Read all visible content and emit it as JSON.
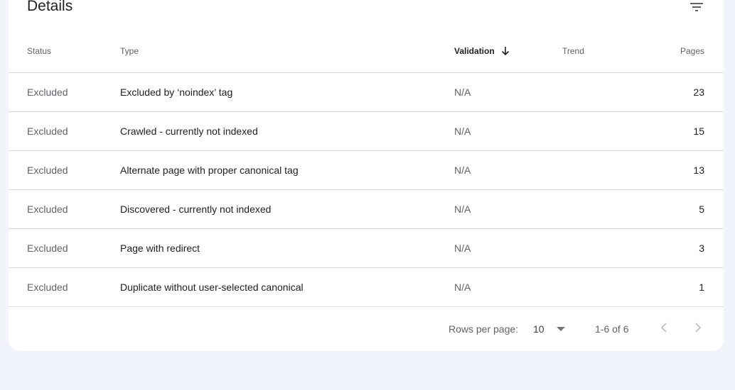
{
  "title": "Details",
  "icons": {
    "filter": "filter-icon",
    "sort": "arrow-down-icon",
    "dropdown": "caret-down-icon",
    "prev": "chevron-left-icon",
    "next": "chevron-right-icon"
  },
  "columns": {
    "status": "Status",
    "type": "Type",
    "validation": "Validation",
    "trend": "Trend",
    "pages": "Pages"
  },
  "rows": [
    {
      "status": "Excluded",
      "type": "Excluded by ‘noindex’ tag",
      "validation": "N/A",
      "pages": "23"
    },
    {
      "status": "Excluded",
      "type": "Crawled - currently not indexed",
      "validation": "N/A",
      "pages": "15"
    },
    {
      "status": "Excluded",
      "type": "Alternate page with proper canonical tag",
      "validation": "N/A",
      "pages": "13"
    },
    {
      "status": "Excluded",
      "type": "Discovered - currently not indexed",
      "validation": "N/A",
      "pages": "5"
    },
    {
      "status": "Excluded",
      "type": "Page with redirect",
      "validation": "N/A",
      "pages": "3"
    },
    {
      "status": "Excluded",
      "type": "Duplicate without user-selected canonical",
      "validation": "N/A",
      "pages": "1"
    }
  ],
  "pagination": {
    "rows_per_page_label": "Rows per page:",
    "rows_per_page_value": "10",
    "range": "1-6 of 6"
  },
  "colors": {
    "background": "#f1f4fb",
    "card": "#ffffff",
    "divider": "#dadce0",
    "text_primary": "#202124",
    "text_secondary": "#5f6368"
  }
}
